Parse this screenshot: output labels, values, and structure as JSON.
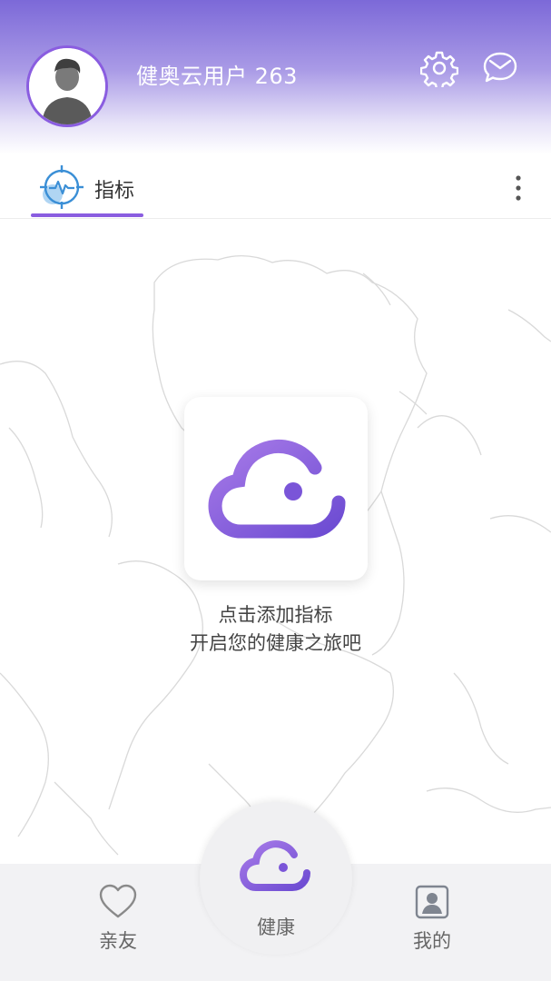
{
  "header": {
    "username": "健奥云用户 263",
    "icons": [
      "gear-icon",
      "message-icon"
    ]
  },
  "tabs": [
    {
      "label": "指标",
      "icon": "heart-pulse-target-icon",
      "active": true
    }
  ],
  "main": {
    "hint_line1": "点击添加指标",
    "hint_line2": "开启您的健康之旅吧"
  },
  "bottom_nav": [
    {
      "label": "亲友",
      "icon": "heart-icon"
    },
    {
      "label": "健康",
      "icon": "cloud-icon",
      "active": true
    },
    {
      "label": "我的",
      "icon": "person-card-icon"
    }
  ],
  "colors": {
    "accent": "#8a5de0",
    "header_top": "#7c69d8",
    "tab_icon_blue": "#4aa3df"
  }
}
